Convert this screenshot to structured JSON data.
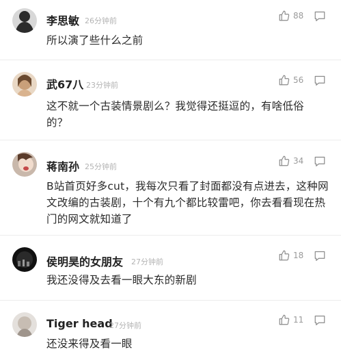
{
  "comments": [
    {
      "username": "李思敏",
      "time": "26分钟前",
      "likes": "88",
      "content": "所以演了些什么之前",
      "avatar_color": "#2b2b2b"
    },
    {
      "username": "武67八",
      "time": "23分钟前",
      "likes": "56",
      "content": "这不就一个古装情景剧么？我觉得还挺逗的，有啥低俗的？",
      "avatar_color": "#c9a07a"
    },
    {
      "username": "蒋南孙",
      "time": "25分钟前",
      "likes": "34",
      "content": "B站首页好多cut，我每次只看了封面都没有点进去，这种网文改编的古装剧，十个有九个都比较雷吧，你去看看现在热门的网文就知道了",
      "avatar_color": "#e8d3c6"
    },
    {
      "username": "侯明昊的女朋友",
      "time": "27分钟前",
      "likes": "18",
      "content": "我还没得及去看一眼大东的新剧",
      "avatar_color": "#1e1e1e"
    },
    {
      "username": "Tiger head",
      "time": "27分钟前",
      "likes": "11",
      "content": "还没来得及看一眼",
      "avatar_color": "#b8b0a8"
    }
  ],
  "icons": {
    "like": "thumbs-up-icon",
    "reply": "comment-icon"
  },
  "colors": {
    "text": "#2a2a2a",
    "username": "#222222",
    "meta": "#b3b3b3",
    "divider": "#ececec"
  }
}
